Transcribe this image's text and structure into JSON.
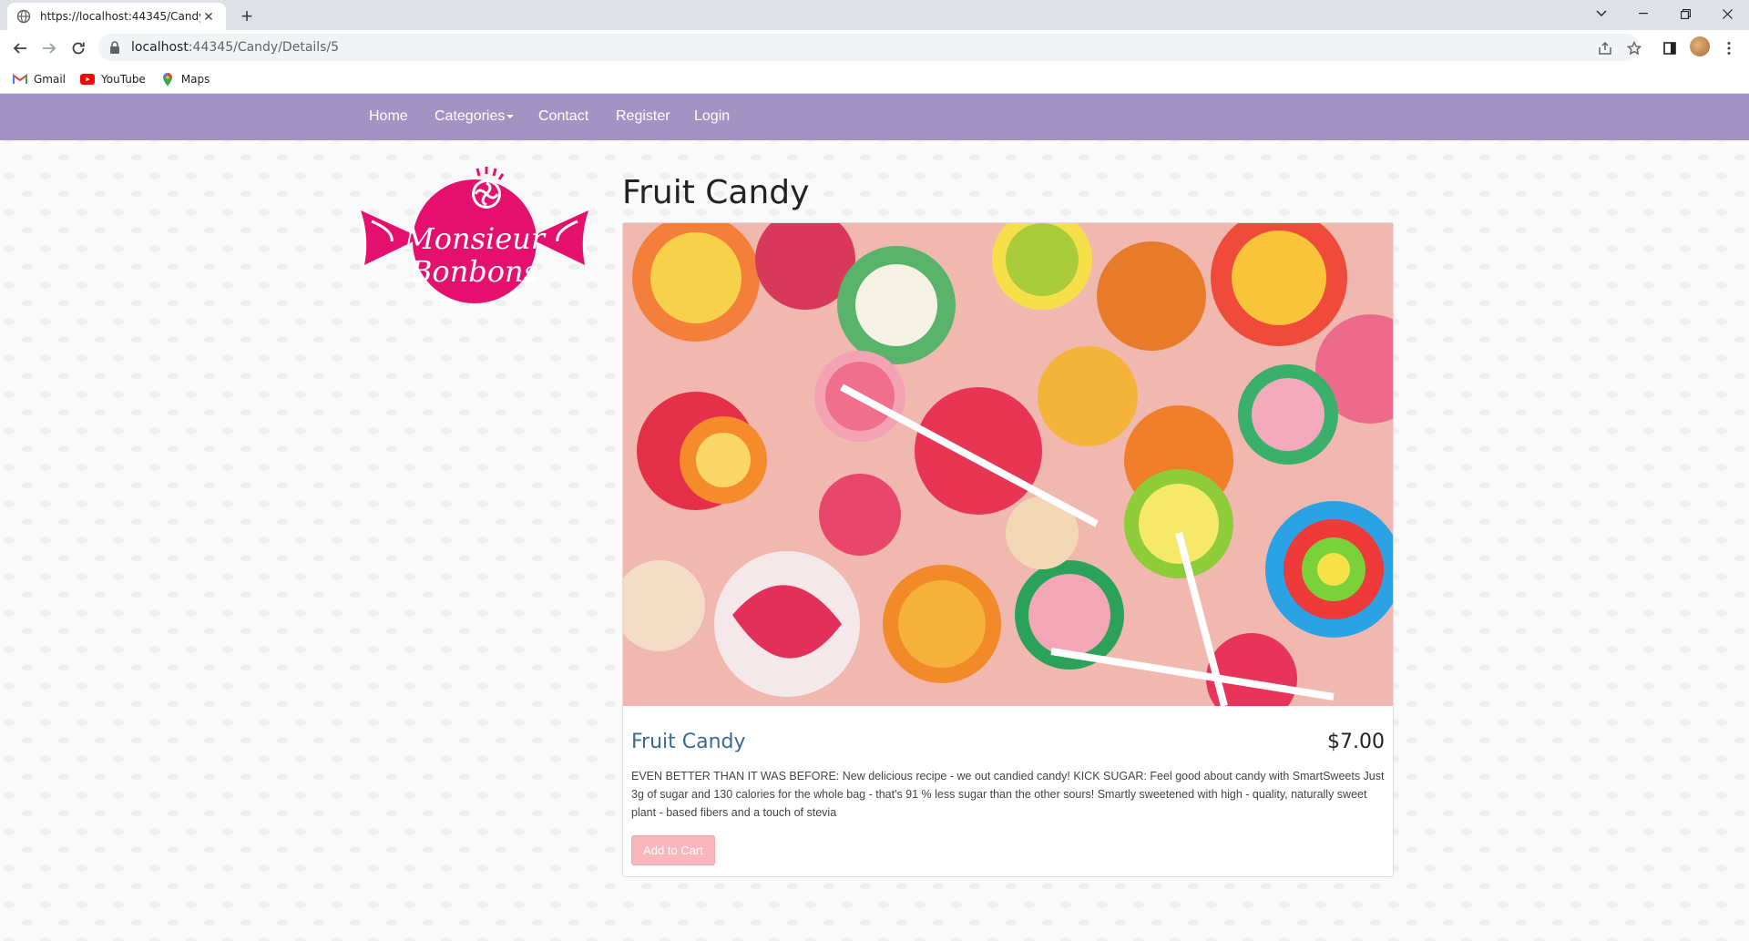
{
  "browser": {
    "tab_title": "https://localhost:44345/Candy/D",
    "url_host": "localhost",
    "url_path": ":44345/Candy/Details/5",
    "bookmarks": [
      {
        "label": "Gmail",
        "icon": "gmail-icon"
      },
      {
        "label": "YouTube",
        "icon": "youtube-icon"
      },
      {
        "label": "Maps",
        "icon": "maps-icon"
      }
    ]
  },
  "nav": {
    "home": "Home",
    "categories": "Categories",
    "contact": "Contact",
    "register": "Register",
    "login": "Login"
  },
  "logo_text": [
    "Monsieur",
    "Bonbons"
  ],
  "product": {
    "title": "Fruit Candy",
    "name": "Fruit Candy",
    "price": "$7.00",
    "description": "EVEN BETTER THAN IT WAS BEFORE: New delicious recipe - we out candied candy! KICK SUGAR: Feel good about candy with SmartSweets Just 3g of sugar and 130 calories for the whole bag - that's 91 % less sugar than the other sours! Smartly sweetened with high - quality, naturally sweet plant - based fibers and a touch of stevia",
    "add_to_cart": "Add to Cart"
  },
  "colors": {
    "navbar": "#a393c3",
    "logo_pink": "#e5106d",
    "button": "#f9b7bd",
    "link": "#3b6a99"
  }
}
